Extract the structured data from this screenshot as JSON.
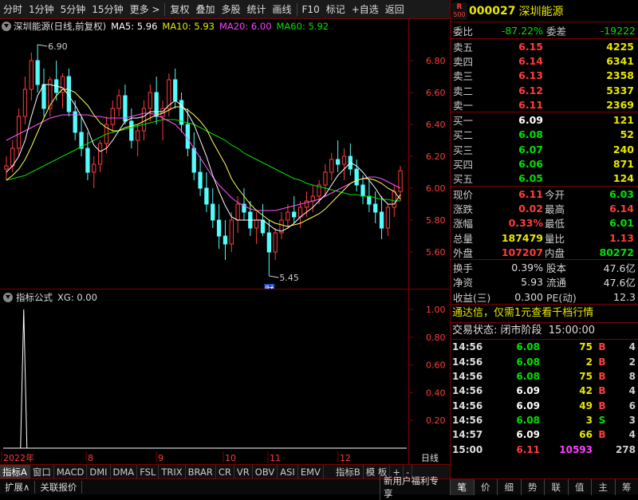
{
  "toolbar": {
    "items": [
      "分时",
      "1分钟",
      "5分钟",
      "15分钟",
      "更多 >",
      "复权",
      "叠加",
      "多股",
      "统计",
      "画线",
      "F10",
      "标记",
      "+自选",
      "返回"
    ]
  },
  "chart_info": {
    "name": "深圳能源(日线,前复权)",
    "ma5": "MA5: 5.96",
    "ma10": "MA10: 5.93",
    "ma20": "MA20: 6.00",
    "ma60": "MA60: 5.92",
    "high_label": "6.90",
    "low_label": "5.45",
    "cai_label": "财"
  },
  "indicator_info": {
    "name": "指标公式",
    "value": "XG: 0.00"
  },
  "colors": {
    "up": "#ff3c3c",
    "down": "#54fcfc",
    "ma5": "#ffffff",
    "ma10": "#ffff54",
    "ma20": "#ff54ff",
    "ma60": "#00e000"
  },
  "xaxis": {
    "labels": [
      "2022年",
      "8",
      "9",
      "10",
      "11",
      "12"
    ],
    "right": "日线"
  },
  "bottom_tabs": [
    "指标A",
    "窗口",
    "MACD",
    "DMI",
    "DMA",
    "FSL",
    "TRIX",
    "BRAR",
    "CR",
    "VR",
    "OBV",
    "ASI",
    "EMV",
    "指标B",
    "模 板",
    "+",
    "-"
  ],
  "statusbar": {
    "left1": "扩展∧",
    "left2": "关联报价",
    "right_promo": "新用户福利专享",
    "tabs": [
      "笔",
      "价",
      "细",
      "势",
      "联",
      "值",
      "主",
      "筹"
    ]
  },
  "quote": {
    "badge_top": "R",
    "badge_bottom": "500",
    "code": "000027",
    "name": "深圳能源",
    "weibi_label": "委比",
    "weibi": "-87.22%",
    "weicha_label": "委差",
    "weicha": "-19222",
    "sell": [
      {
        "label": "卖五",
        "price": "6.15",
        "vol": "4225"
      },
      {
        "label": "卖四",
        "price": "6.14",
        "vol": "6341"
      },
      {
        "label": "卖三",
        "price": "6.13",
        "vol": "2358"
      },
      {
        "label": "卖二",
        "price": "6.12",
        "vol": "5337"
      },
      {
        "label": "卖一",
        "price": "6.11",
        "vol": "2369"
      }
    ],
    "buy": [
      {
        "label": "买一",
        "price": "6.09",
        "vol": "121"
      },
      {
        "label": "买二",
        "price": "6.08",
        "vol": "52"
      },
      {
        "label": "买三",
        "price": "6.07",
        "vol": "240"
      },
      {
        "label": "买四",
        "price": "6.06",
        "vol": "871"
      },
      {
        "label": "买五",
        "price": "6.05",
        "vol": "124"
      }
    ],
    "stats": [
      {
        "l1": "现价",
        "v1": "6.11",
        "l2": "今开",
        "v2": "6.03"
      },
      {
        "l1": "涨跌",
        "v1": "0.02",
        "l2": "最高",
        "v2": "6.14"
      },
      {
        "l1": "涨幅",
        "v1": "0.33%",
        "l2": "最低",
        "v2": "6.01"
      },
      {
        "l1": "总量",
        "v1": "187479",
        "l2": "量比",
        "v2": "1.13"
      },
      {
        "l1": "外盘",
        "v1": "107207",
        "l2": "内盘",
        "v2": "80272"
      }
    ],
    "stats2": [
      {
        "l1": "换手",
        "v1": "0.39%",
        "l2": "股本",
        "v2": "47.6亿"
      },
      {
        "l1": "净资",
        "v1": "5.93",
        "l2": "流通",
        "v2": "47.6亿"
      },
      {
        "l1": "收益(三)",
        "v1": "0.300",
        "l2": "PE(动)",
        "v2": "12.3"
      }
    ],
    "promo": "通达信，仅需1元查看千档行情",
    "trade_status_label": "交易状态:",
    "trade_status": "闭市阶段",
    "trade_time": "15:00:00",
    "ticks": [
      {
        "t": "14:56",
        "p": "6.08",
        "v": "75",
        "s": "B",
        "n": "4"
      },
      {
        "t": "14:56",
        "p": "6.08",
        "v": "2",
        "s": "B",
        "n": "2"
      },
      {
        "t": "14:56",
        "p": "6.08",
        "v": "75",
        "s": "B",
        "n": "8"
      },
      {
        "t": "14:56",
        "p": "6.09",
        "v": "42",
        "s": "B",
        "n": "4"
      },
      {
        "t": "14:56",
        "p": "6.09",
        "v": "49",
        "s": "B",
        "n": "6"
      },
      {
        "t": "14:56",
        "p": "6.08",
        "v": "3",
        "s": "S",
        "n": "3"
      },
      {
        "t": "14:57",
        "p": "6.09",
        "v": "66",
        "s": "B",
        "n": "4"
      },
      {
        "t": "15:00",
        "p": "6.11",
        "v": "10593",
        "s": "",
        "n": "278"
      }
    ]
  },
  "chart_data": {
    "type": "candlestick",
    "y_ticks": [
      "6.80",
      "6.60",
      "6.40",
      "6.20",
      "6.00",
      "5.80",
      "5.60"
    ],
    "ylim": [
      5.45,
      6.93
    ],
    "ind_ticks": [
      "1.00",
      "0.80",
      "0.60",
      "0.40",
      "0.20"
    ],
    "candles": [
      [
        6.12,
        6.2,
        6.05,
        6.14
      ],
      [
        6.14,
        6.3,
        6.1,
        6.25
      ],
      [
        6.25,
        6.5,
        6.2,
        6.45
      ],
      [
        6.45,
        6.7,
        6.4,
        6.62
      ],
      [
        6.62,
        6.85,
        6.55,
        6.8
      ],
      [
        6.8,
        6.9,
        6.6,
        6.65
      ],
      [
        6.65,
        6.75,
        6.45,
        6.5
      ],
      [
        6.5,
        6.7,
        6.45,
        6.68
      ],
      [
        6.68,
        6.8,
        6.55,
        6.6
      ],
      [
        6.6,
        6.72,
        6.5,
        6.7
      ],
      [
        6.7,
        6.75,
        6.45,
        6.48
      ],
      [
        6.48,
        6.55,
        6.3,
        6.35
      ],
      [
        6.35,
        6.45,
        6.2,
        6.25
      ],
      [
        6.25,
        6.35,
        6.05,
        6.1
      ],
      [
        6.1,
        6.2,
        6.0,
        6.15
      ],
      [
        6.15,
        6.3,
        6.1,
        6.28
      ],
      [
        6.28,
        6.45,
        6.22,
        6.4
      ],
      [
        6.4,
        6.55,
        6.35,
        6.5
      ],
      [
        6.5,
        6.62,
        6.45,
        6.58
      ],
      [
        6.58,
        6.65,
        6.4,
        6.42
      ],
      [
        6.42,
        6.5,
        6.25,
        6.3
      ],
      [
        6.3,
        6.4,
        6.2,
        6.36
      ],
      [
        6.36,
        6.55,
        6.3,
        6.5
      ],
      [
        6.5,
        6.65,
        6.42,
        6.6
      ],
      [
        6.6,
        6.7,
        6.4,
        6.45
      ],
      [
        6.45,
        6.55,
        6.3,
        6.5
      ],
      [
        6.5,
        6.72,
        6.45,
        6.68
      ],
      [
        6.68,
        6.75,
        6.5,
        6.55
      ],
      [
        6.55,
        6.6,
        6.35,
        6.4
      ],
      [
        6.4,
        6.5,
        6.2,
        6.25
      ],
      [
        6.25,
        6.35,
        6.05,
        6.1
      ],
      [
        6.1,
        6.2,
        5.95,
        6.0
      ],
      [
        6.0,
        6.1,
        5.85,
        5.9
      ],
      [
        5.9,
        6.0,
        5.75,
        5.8
      ],
      [
        5.8,
        5.9,
        5.62,
        5.7
      ],
      [
        5.7,
        5.8,
        5.55,
        5.65
      ],
      [
        5.65,
        5.85,
        5.6,
        5.8
      ],
      [
        5.8,
        5.95,
        5.72,
        5.9
      ],
      [
        5.9,
        6.0,
        5.8,
        5.85
      ],
      [
        5.85,
        5.92,
        5.7,
        5.75
      ],
      [
        5.75,
        5.85,
        5.65,
        5.8
      ],
      [
        5.8,
        5.9,
        5.7,
        5.72
      ],
      [
        5.72,
        5.8,
        5.45,
        5.6
      ],
      [
        5.6,
        5.75,
        5.55,
        5.72
      ],
      [
        5.72,
        5.85,
        5.68,
        5.8
      ],
      [
        5.8,
        5.9,
        5.75,
        5.85
      ],
      [
        5.85,
        5.95,
        5.78,
        5.82
      ],
      [
        5.82,
        5.92,
        5.75,
        5.88
      ],
      [
        5.88,
        5.98,
        5.82,
        5.92
      ],
      [
        5.92,
        6.02,
        5.85,
        5.95
      ],
      [
        5.95,
        6.05,
        5.9,
        6.02
      ],
      [
        6.02,
        6.15,
        5.95,
        6.1
      ],
      [
        6.1,
        6.22,
        6.05,
        6.18
      ],
      [
        6.18,
        6.3,
        6.1,
        6.15
      ],
      [
        6.15,
        6.25,
        6.05,
        6.2
      ],
      [
        6.2,
        6.28,
        6.08,
        6.12
      ],
      [
        6.12,
        6.18,
        5.98,
        6.02
      ],
      [
        6.02,
        6.08,
        5.9,
        5.95
      ],
      [
        5.95,
        6.05,
        5.85,
        5.9
      ],
      [
        5.9,
        5.98,
        5.78,
        5.85
      ],
      [
        5.85,
        5.95,
        5.68,
        5.75
      ],
      [
        5.75,
        5.9,
        5.7,
        5.88
      ],
      [
        5.88,
        6.02,
        5.82,
        5.98
      ],
      [
        5.98,
        6.14,
        5.92,
        6.11
      ]
    ],
    "ma5": [
      6.1,
      6.14,
      6.2,
      6.3,
      6.45,
      6.58,
      6.65,
      6.65,
      6.64,
      6.63,
      6.58,
      6.52,
      6.45,
      6.37,
      6.27,
      6.23,
      6.25,
      6.3,
      6.36,
      6.42,
      6.44,
      6.44,
      6.45,
      6.48,
      6.48,
      6.48,
      6.52,
      6.55,
      6.52,
      6.47,
      6.4,
      6.3,
      6.2,
      6.08,
      5.98,
      5.89,
      5.82,
      5.8,
      5.8,
      5.8,
      5.8,
      5.8,
      5.77,
      5.74,
      5.73,
      5.75,
      5.78,
      5.82,
      5.85,
      5.88,
      5.92,
      5.96,
      6.02,
      6.08,
      6.12,
      6.16,
      6.14,
      6.1,
      6.05,
      6.0,
      5.94,
      5.9,
      5.9,
      5.96
    ],
    "ma10": [
      6.05,
      6.08,
      6.12,
      6.18,
      6.26,
      6.35,
      6.44,
      6.52,
      6.58,
      6.62,
      6.62,
      6.6,
      6.56,
      6.52,
      6.46,
      6.41,
      6.38,
      6.36,
      6.36,
      6.38,
      6.39,
      6.4,
      6.42,
      6.44,
      6.46,
      6.47,
      6.49,
      6.51,
      6.51,
      6.49,
      6.46,
      6.42,
      6.37,
      6.29,
      6.22,
      6.15,
      6.06,
      6.0,
      5.95,
      5.9,
      5.86,
      5.83,
      5.8,
      5.78,
      5.77,
      5.76,
      5.77,
      5.78,
      5.8,
      5.82,
      5.84,
      5.87,
      5.91,
      5.95,
      5.99,
      6.03,
      6.05,
      6.06,
      6.06,
      6.05,
      6.03,
      6.0,
      5.98,
      5.93
    ],
    "ma20": [
      6.3,
      6.32,
      6.34,
      6.36,
      6.38,
      6.4,
      6.42,
      6.44,
      6.45,
      6.46,
      6.46,
      6.46,
      6.46,
      6.46,
      6.45,
      6.45,
      6.44,
      6.44,
      6.44,
      6.44,
      6.45,
      6.46,
      6.47,
      6.47,
      6.46,
      6.44,
      6.42,
      6.4,
      6.36,
      6.31,
      6.25,
      6.19,
      6.13,
      6.07,
      6.02,
      5.98,
      5.94,
      5.91,
      5.89,
      5.87,
      5.86,
      5.86,
      5.86,
      5.86,
      5.87,
      5.88,
      5.89,
      5.9,
      5.91,
      5.92,
      5.93,
      5.95,
      5.97,
      5.99,
      6.01,
      6.03,
      6.05,
      6.06,
      6.07,
      6.07,
      6.06,
      6.04,
      6.02,
      6.0
    ],
    "ma60": [
      6.05,
      6.06,
      6.07,
      6.08,
      6.1,
      6.12,
      6.14,
      6.16,
      6.18,
      6.2,
      6.22,
      6.24,
      6.26,
      6.28,
      6.3,
      6.32,
      6.34,
      6.35,
      6.36,
      6.37,
      6.38,
      6.39,
      6.4,
      6.41,
      6.42,
      6.43,
      6.43,
      6.43,
      6.42,
      6.41,
      6.4,
      6.38,
      6.36,
      6.34,
      6.32,
      6.3,
      6.27,
      6.25,
      6.22,
      6.2,
      6.18,
      6.16,
      6.14,
      6.12,
      6.1,
      6.08,
      6.06,
      6.05,
      6.03,
      6.02,
      6.01,
      6.0,
      5.99,
      5.98,
      5.97,
      5.96,
      5.96,
      5.95,
      5.95,
      5.94,
      5.93,
      5.93,
      5.92,
      5.92
    ],
    "indicator": {
      "spike_index": 1,
      "value": 1.0
    }
  }
}
